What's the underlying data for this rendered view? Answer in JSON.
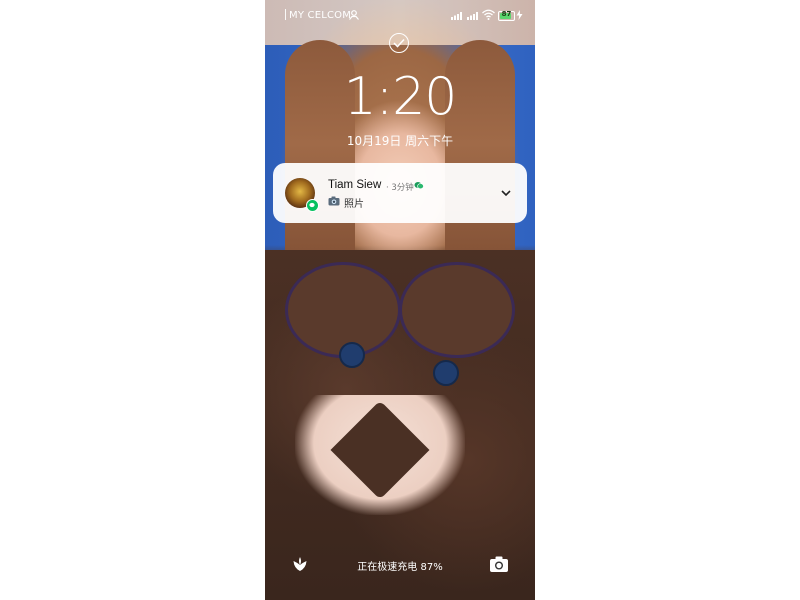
{
  "status_bar": {
    "carrier": "MY CELCOM",
    "battery_level": "87",
    "battery_fraction": 0.87
  },
  "lock_screen": {
    "time": "1:20",
    "date": "10月19日 周六下午"
  },
  "notification": {
    "sender": "Tiam Siew",
    "time_ago": "· 3分钟",
    "message": "照片",
    "message_icon": "camera-icon",
    "app_icon": "wechat-icon"
  },
  "bottom_bar": {
    "charging_status": "正在极速充电 87%",
    "left_icon": "leaf-icon",
    "right_icon": "camera-icon"
  },
  "colors": {
    "wechat_green": "#07c160",
    "battery_green": "#5ad66d"
  }
}
